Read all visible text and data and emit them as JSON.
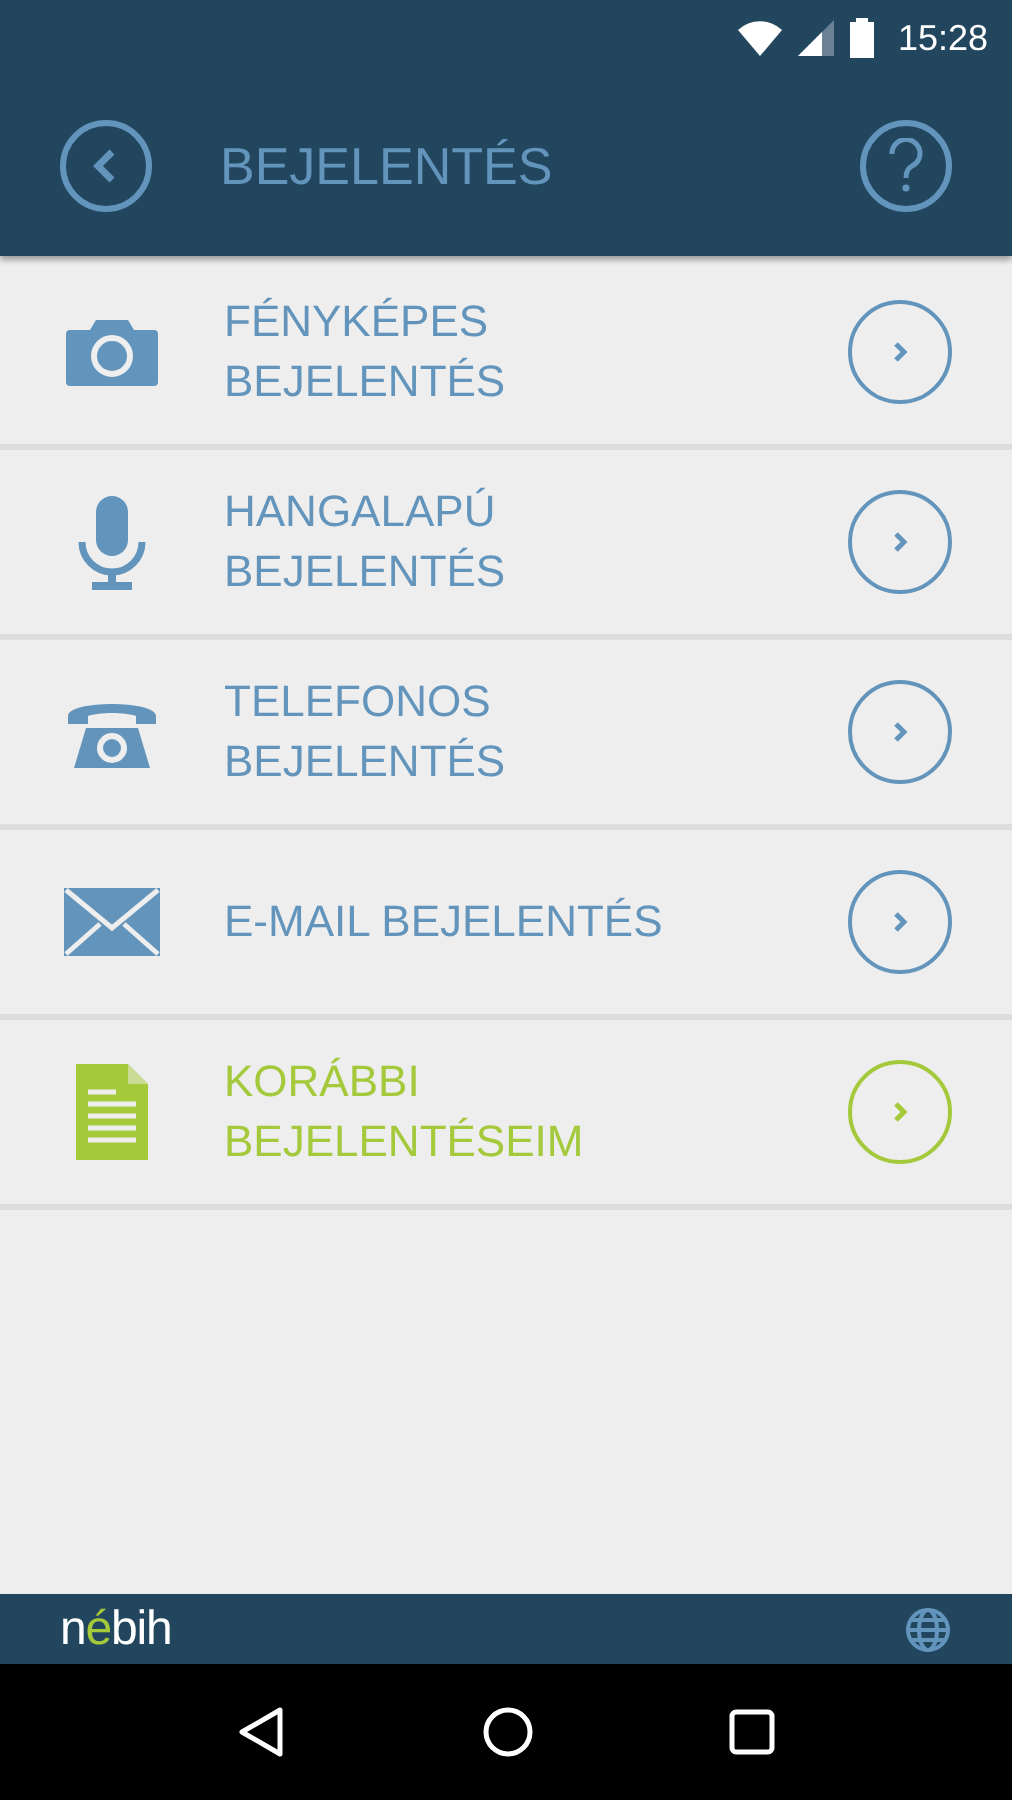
{
  "status_bar": {
    "time": "15:28"
  },
  "header": {
    "title": "BEJELENTÉS"
  },
  "items": [
    {
      "kind": "camera",
      "lines": [
        "FÉNYKÉPES",
        "BEJELENTÉS"
      ],
      "color": "#6395bc"
    },
    {
      "kind": "microphone",
      "lines": [
        "HANGALAPÚ",
        "BEJELENTÉS"
      ],
      "color": "#6395bc"
    },
    {
      "kind": "phone",
      "lines": [
        "TELEFONOS",
        "BEJELENTÉS"
      ],
      "color": "#6395bc"
    },
    {
      "kind": "mail",
      "lines": [
        "E-MAIL BEJELENTÉS"
      ],
      "color": "#6395bc"
    },
    {
      "kind": "document",
      "lines": [
        "KORÁBBI",
        "BEJELENTÉSEIM"
      ],
      "color": "#a4c93a"
    }
  ],
  "footer": {
    "logo": [
      {
        "text": "n",
        "color": "#ffffff"
      },
      {
        "text": "é",
        "color": "#a4c93a"
      },
      {
        "text": "bih",
        "color": "#ffffff"
      }
    ]
  }
}
